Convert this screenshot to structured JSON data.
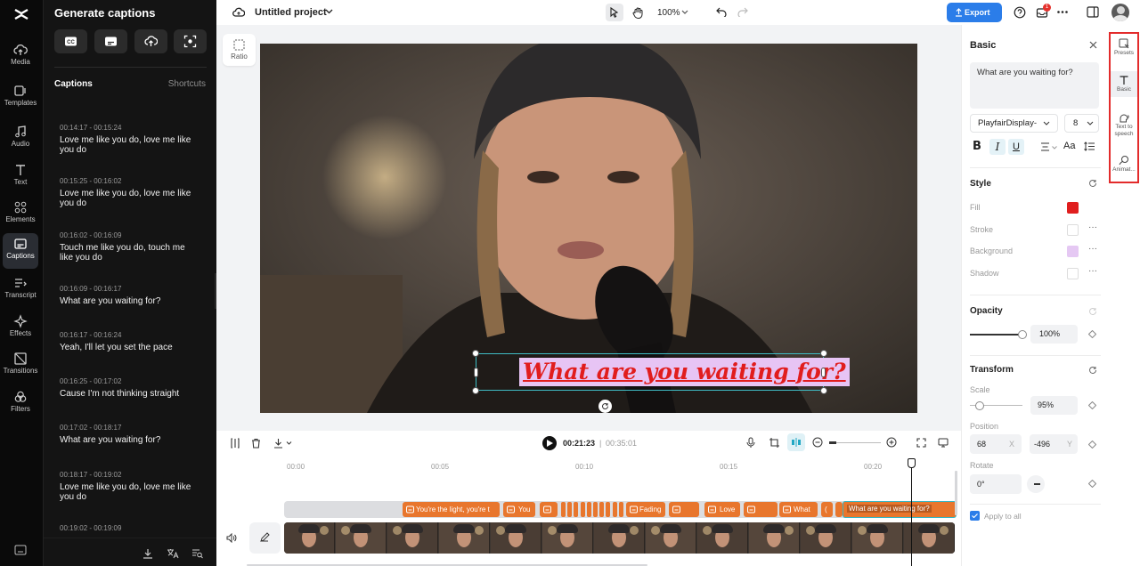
{
  "rail": {
    "items": [
      {
        "label": "Media"
      },
      {
        "label": "Templates"
      },
      {
        "label": "Audio"
      },
      {
        "label": "Text"
      },
      {
        "label": "Elements"
      },
      {
        "label": "Captions"
      },
      {
        "label": "Transcript"
      },
      {
        "label": "Effects"
      },
      {
        "label": "Transitions"
      },
      {
        "label": "Filters"
      }
    ]
  },
  "panel": {
    "title": "Generate captions",
    "captions_heading": "Captions",
    "shortcuts": "Shortcuts",
    "captions": [
      {
        "time": "00:14:17 - 00:15:24",
        "text": "Love me like you do, love me like you do"
      },
      {
        "time": "00:15:25 - 00:16:02",
        "text": "Love me like you do, love me like you do"
      },
      {
        "time": "00:16:02 - 00:16:09",
        "text": "Touch me like you do, touch me like you do"
      },
      {
        "time": "00:16:09 - 00:16:17",
        "text": "What are you waiting for?"
      },
      {
        "time": "00:16:17 - 00:16:24",
        "text": "Yeah, I'll let you set the pace"
      },
      {
        "time": "00:16:25 - 00:17:02",
        "text": "Cause I'm not thinking straight"
      },
      {
        "time": "00:17:02 - 00:18:17",
        "text": "What are you waiting for?"
      },
      {
        "time": "00:18:17 - 00:19:02",
        "text": "Love me like you do, love me like you do"
      },
      {
        "time": "00:19:02 - 00:19:09",
        "text": ""
      }
    ]
  },
  "topbar": {
    "project_title": "Untitled project",
    "zoom": "100%",
    "export_label": "Export",
    "notif_count": "1"
  },
  "canvas": {
    "ratio_label": "Ratio",
    "caption_text": "What are you waiting for?"
  },
  "timeline": {
    "current_time": "00:21:23",
    "total_time": "00:35:01",
    "ticks": [
      "00:00",
      "00:05",
      "00:10",
      "00:15",
      "00:20"
    ],
    "clips": [
      "You're the light, you're t",
      "You",
      "",
      "Fading",
      "Love",
      "What",
      "(",
      "What are you waiting for?"
    ]
  },
  "right": {
    "title": "Basic",
    "text_value": "What are you waiting for?",
    "font": "PlayfairDisplay-",
    "font_size": "8",
    "style_heading": "Style",
    "fill_label": "Fill",
    "stroke_label": "Stroke",
    "background_label": "Background",
    "shadow_label": "Shadow",
    "fill_color": "#e01e1e",
    "background_color": "#e5c8f3",
    "opacity_heading": "Opacity",
    "opacity_value": "100%",
    "opacity_level": 1.0,
    "transform_heading": "Transform",
    "scale_label": "Scale",
    "scale_value": "95%",
    "scale_level": 0.07,
    "position_label": "Position",
    "pos_x": "68",
    "pos_x_axis": "X",
    "pos_y": "-496",
    "pos_y_axis": "Y",
    "rotate_label": "Rotate",
    "rotate_value": "0°",
    "apply_all": "Apply to all"
  },
  "tabs": [
    {
      "label": "Presets"
    },
    {
      "label": "Basic"
    },
    {
      "label": "Text to speech"
    },
    {
      "label": "Animat..."
    }
  ],
  "colors": {
    "accent": "#2b7de9",
    "selection": "#3fbcc4",
    "clip": "#e8762d"
  }
}
